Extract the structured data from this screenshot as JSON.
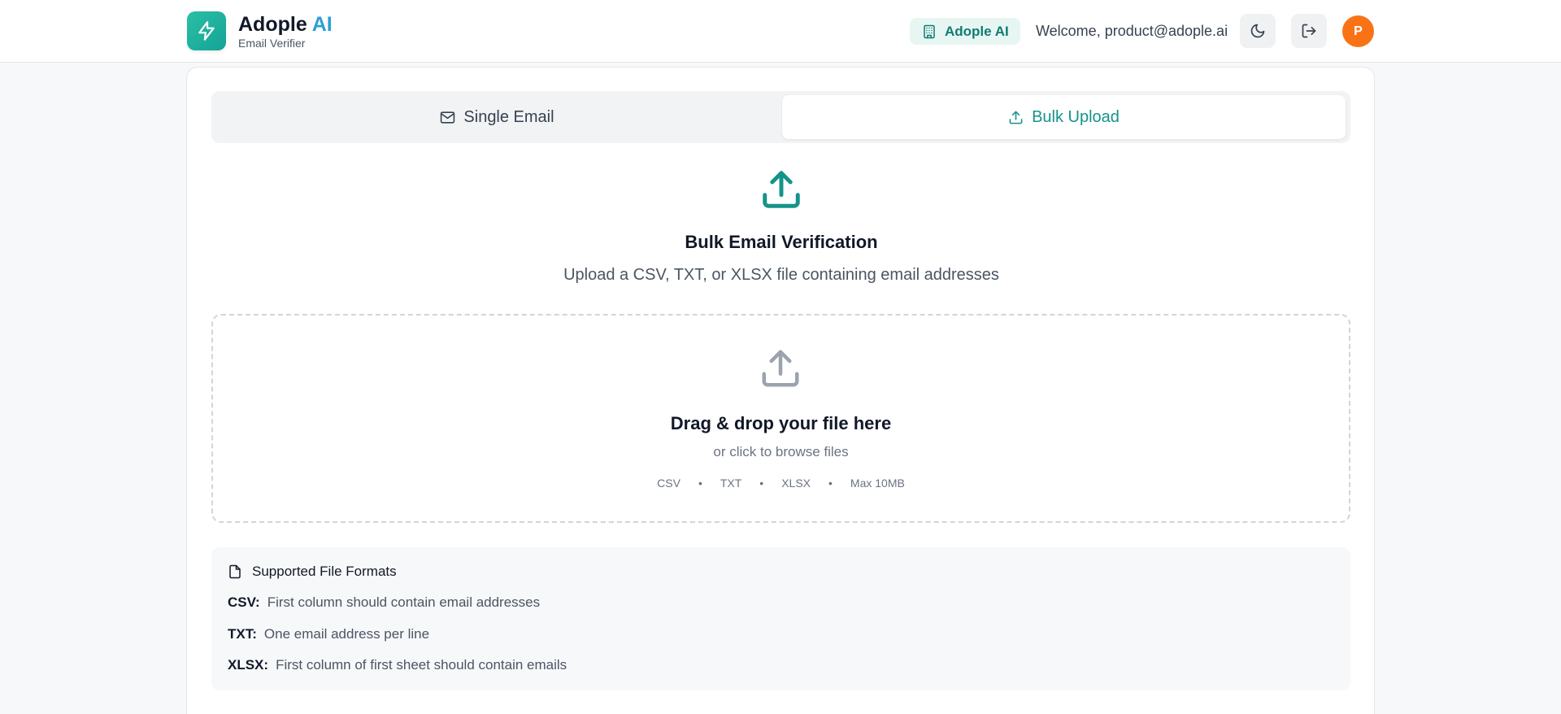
{
  "header": {
    "brand_name": "Adople",
    "brand_accent": "AI",
    "brand_sub": "Email Verifier",
    "org_label": "Adople AI",
    "welcome": "Welcome, product@adople.ai",
    "avatar_initial": "P",
    "icons": {
      "logo": "lightning-icon",
      "org": "building-icon",
      "theme": "moon-icon",
      "logout": "logout-icon"
    }
  },
  "tabs": {
    "single_label": "Single Email",
    "bulk_label": "Bulk Upload",
    "active": "Bulk Upload"
  },
  "hero": {
    "title": "Bulk Email Verification",
    "subtitle": "Upload a CSV, TXT, or XLSX file containing email addresses"
  },
  "dropzone": {
    "title": "Drag & drop your file here",
    "subtitle": "or click to browse files",
    "formats": [
      "CSV",
      "TXT",
      "XLSX",
      "Max 10MB"
    ],
    "separator": "•"
  },
  "info": {
    "heading": "Supported File Formats",
    "rows": [
      {
        "label": "CSV:",
        "text": "First column should contain email addresses"
      },
      {
        "label": "TXT:",
        "text": "One email address per line"
      },
      {
        "label": "XLSX:",
        "text": "First column of first sheet should contain emails"
      }
    ]
  },
  "colors": {
    "accent": "#14938a",
    "brand_ai": "#2d9fd4",
    "avatar": "#f97316",
    "background": "#f6f8fa"
  }
}
